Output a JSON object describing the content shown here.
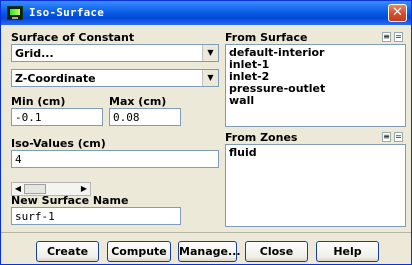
{
  "window": {
    "title": "Iso-Surface",
    "close_glyph": "✕"
  },
  "left": {
    "surface_of_constant_label": "Surface of Constant",
    "dropdown1_value": "Grid...",
    "dropdown2_value": "Z-Coordinate",
    "min_label": "Min (cm)",
    "max_label": "Max (cm)",
    "min_value": "-0.1",
    "max_value": "0.08",
    "iso_values_label": "Iso-Values (cm)",
    "iso_values_value": "4",
    "new_surface_label": "New Surface Name",
    "new_surface_value": "surf-1"
  },
  "right": {
    "from_surface_label": "From Surface",
    "surfaces": [
      "default-interior",
      "inlet-1",
      "inlet-2",
      "pressure-outlet",
      "wall"
    ],
    "from_zones_label": "From Zones",
    "zones": [
      "fluid"
    ]
  },
  "buttons": {
    "create": "Create",
    "compute": "Compute",
    "manage": "Manage...",
    "close": "Close",
    "help": "Help"
  },
  "icons": {
    "dropdown_arrow": "▼",
    "scroll_left": "◀",
    "scroll_right": "▶",
    "select_all": "≡",
    "deselect_all": "="
  }
}
